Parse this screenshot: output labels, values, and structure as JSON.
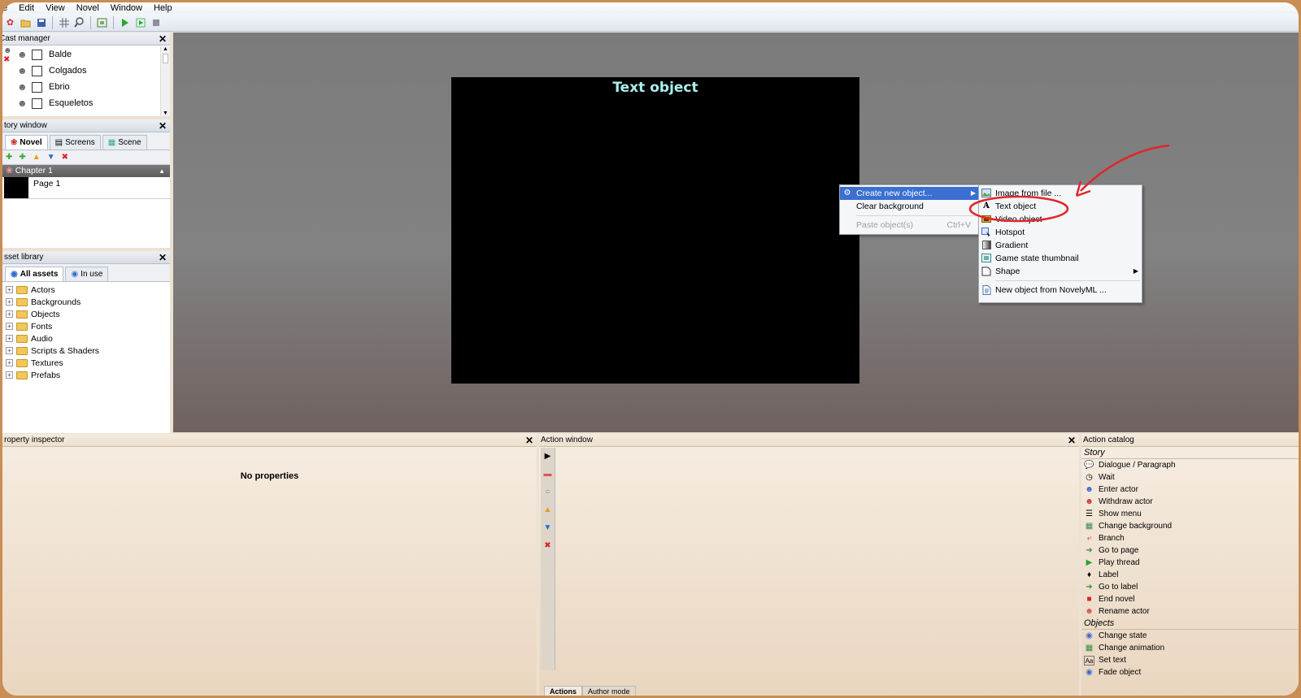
{
  "menubar": [
    "e",
    "Edit",
    "View",
    "Novel",
    "Window",
    "Help"
  ],
  "cast_manager": {
    "title": "Cast manager",
    "items": [
      "Balde",
      "Colgados",
      "Ebrio",
      "Esqueletos"
    ]
  },
  "story_window": {
    "title": "tory window",
    "tabs": [
      "Novel",
      "Screens",
      "Scene"
    ],
    "chapter": "Chapter 1",
    "page": "Page 1"
  },
  "asset_library": {
    "title": "sset library",
    "tabs": [
      "All assets",
      "In use"
    ],
    "folders": [
      "Actors",
      "Backgrounds",
      "Objects",
      "Fonts",
      "Audio",
      "Scripts & Shaders",
      "Textures",
      "Prefabs"
    ]
  },
  "canvas": {
    "text": "Text object"
  },
  "context_menu": {
    "items": [
      {
        "label": "Create new object...",
        "highlighted": true,
        "submenu": true
      },
      {
        "label": "Clear background"
      },
      {
        "label": "Paste object(s)",
        "shortcut": "Ctrl+V",
        "disabled": true
      }
    ]
  },
  "submenu": {
    "items": [
      {
        "label": "Image from file ...",
        "icon": "image-icon"
      },
      {
        "label": "Text object",
        "icon": "text-a-icon"
      },
      {
        "label": "Video object",
        "icon": "film-icon"
      },
      {
        "label": "Hotspot",
        "icon": "hotspot-icon"
      },
      {
        "label": "Gradient",
        "icon": "gradient-icon"
      },
      {
        "label": "Game state thumbnail",
        "icon": "thumbnail-icon"
      },
      {
        "label": "Shape",
        "icon": "shape-icon",
        "submenu": true
      },
      {
        "label": "New object from NovelyML ...",
        "icon": "document-icon"
      }
    ]
  },
  "property_inspector": {
    "title": "roperty inspector",
    "empty": "No properties"
  },
  "action_window": {
    "title": "Action window",
    "tabs": [
      "Actions",
      "Author mode"
    ]
  },
  "action_catalog": {
    "title": "Action catalog",
    "story_heading": "Story",
    "story": [
      "Dialogue / Paragraph",
      "Wait",
      "Enter actor",
      "Withdraw actor",
      "Show menu",
      "Change background",
      "Branch",
      "Go to page",
      "Play thread",
      "Label",
      "Go to label",
      "End novel",
      "Rename actor"
    ],
    "objects_heading": "Objects",
    "objects": [
      "Change state",
      "Change animation",
      "Set text",
      "Fade object"
    ]
  },
  "colors": {
    "frame": "#c98d55",
    "highlight": "#3b6fd1",
    "annotation": "#e0262b",
    "canvas_text": "#a9f0ee"
  }
}
